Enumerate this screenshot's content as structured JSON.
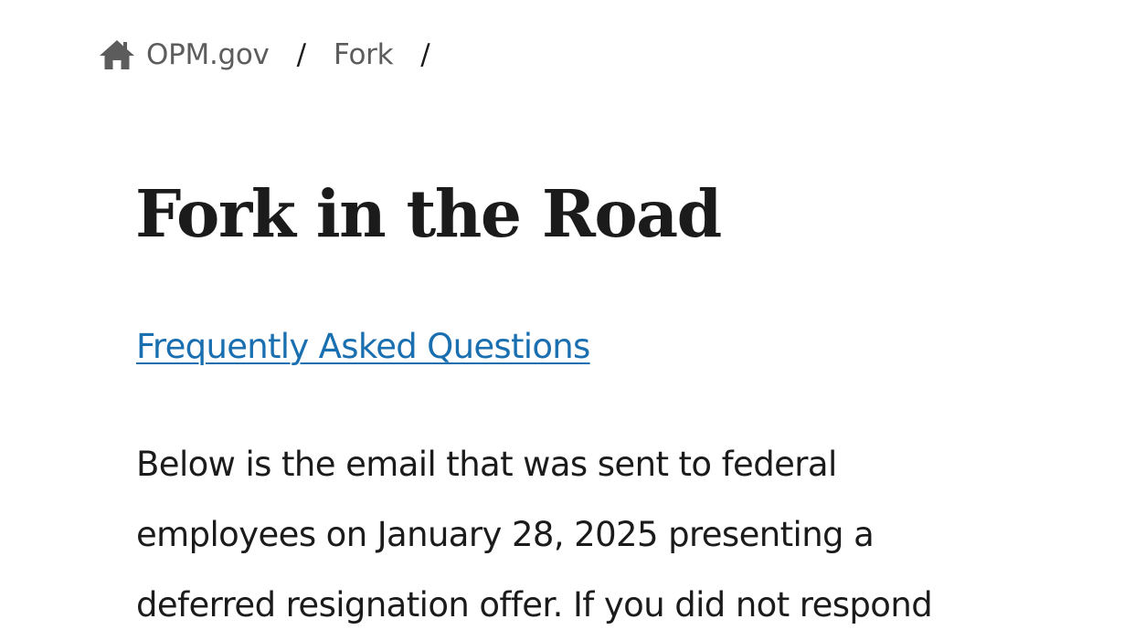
{
  "breadcrumb": {
    "items": [
      {
        "label": "OPM.gov",
        "icon": "home-icon"
      },
      {
        "label": "Fork"
      }
    ],
    "separator": "/"
  },
  "page": {
    "title": "Fork in the Road",
    "faq_link": "Frequently Asked Questions",
    "intro_lines": [
      "Below is the email that was sent to federal",
      "employees on January 28, 2025 presenting a",
      "deferred resignation offer. If you did not respond"
    ]
  },
  "colors": {
    "text": "#1b1b1b",
    "breadcrumb_text": "#5c5c5c",
    "link": "#1a6fb0",
    "background": "#ffffff"
  }
}
